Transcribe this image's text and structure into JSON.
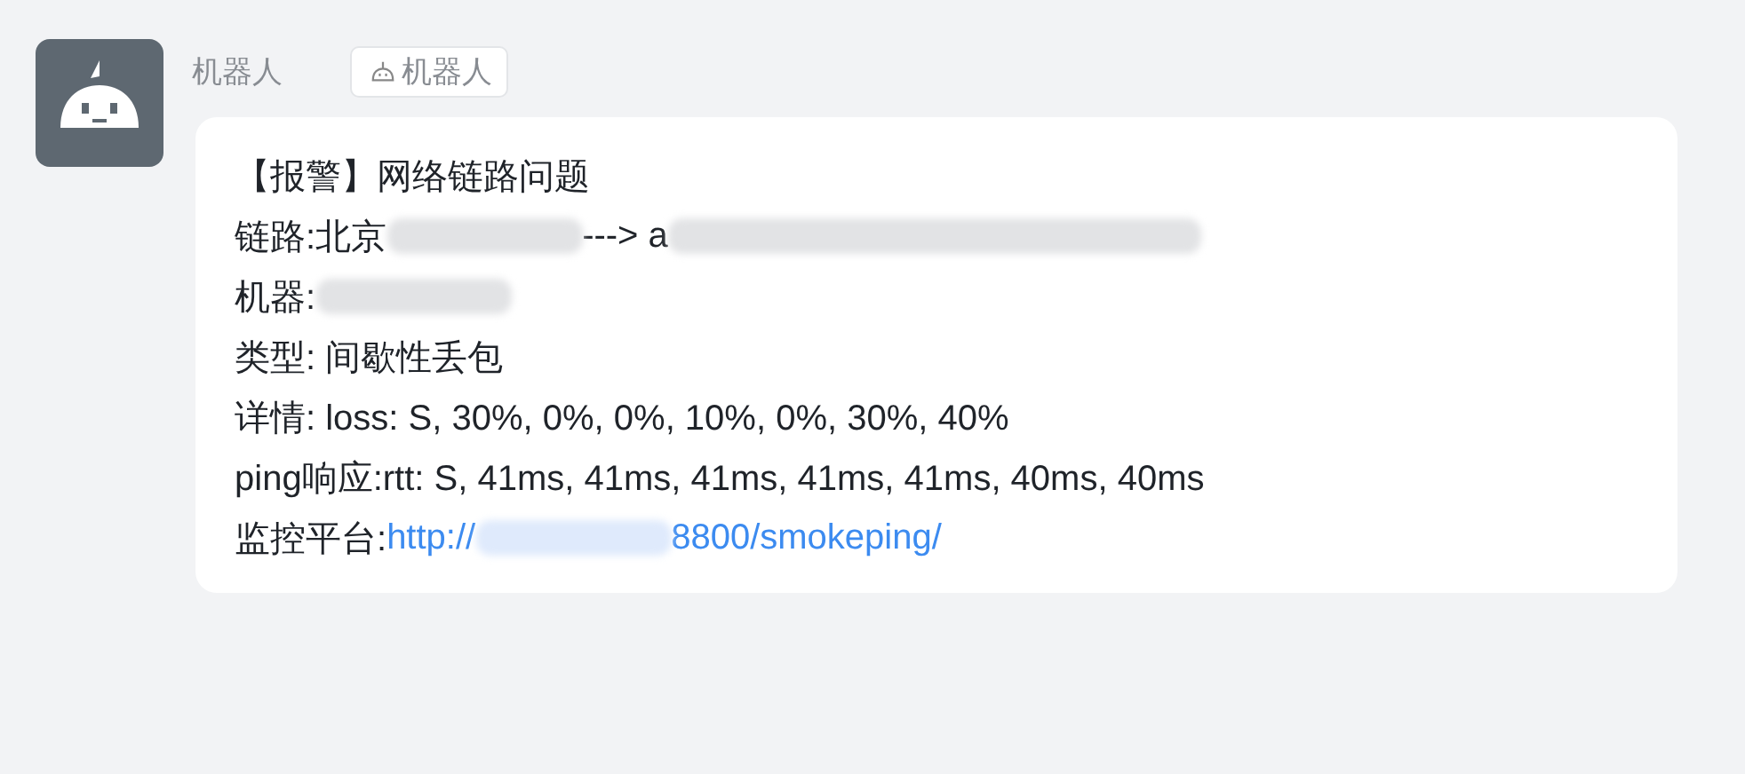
{
  "sender": {
    "name": "机器人",
    "tag": "机器人"
  },
  "message": {
    "lines": [
      {
        "parts": [
          {
            "kind": "text",
            "text": "【报警】网络链路问题"
          }
        ]
      },
      {
        "parts": [
          {
            "kind": "text",
            "text": "链路:北京"
          },
          {
            "kind": "redacted"
          },
          {
            "kind": "text",
            "text": "---> a"
          },
          {
            "kind": "redacted-long"
          }
        ]
      },
      {
        "parts": [
          {
            "kind": "text",
            "text": "机器:"
          },
          {
            "kind": "redacted"
          }
        ]
      },
      {
        "parts": [
          {
            "kind": "text",
            "text": "类型: 间歇性丢包"
          }
        ]
      },
      {
        "parts": [
          {
            "kind": "text",
            "text": "详情: loss: S, 30%, 0%, 0%, 10%, 0%, 30%, 40%"
          }
        ]
      },
      {
        "parts": [
          {
            "kind": "text",
            "text": "ping响应:rtt: S, 41ms, 41ms, 41ms, 41ms, 41ms, 40ms, 40ms"
          }
        ]
      },
      {
        "parts": [
          {
            "kind": "text",
            "text": "监控平台:"
          },
          {
            "kind": "link",
            "text": "http://"
          },
          {
            "kind": "redacted-link"
          },
          {
            "kind": "link",
            "text": "8800/smokeping/"
          }
        ]
      }
    ]
  }
}
